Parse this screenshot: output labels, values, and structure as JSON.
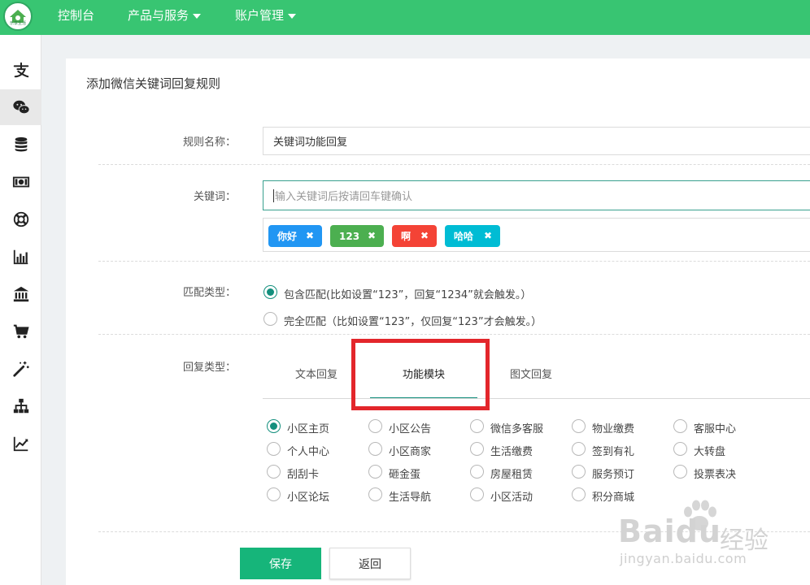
{
  "logo": {
    "label": "乐享生活"
  },
  "header": {
    "nav": [
      {
        "label": "控制台",
        "has_dropdown": false
      },
      {
        "label": "产品与服务",
        "has_dropdown": true
      },
      {
        "label": "账户管理",
        "has_dropdown": true
      }
    ],
    "accent": "#38c572"
  },
  "sidebar": {
    "items": [
      {
        "icon": "alipay-icon",
        "active": false
      },
      {
        "icon": "wechat-icon",
        "active": true
      },
      {
        "icon": "database-icon",
        "active": false
      },
      {
        "icon": "money-icon",
        "active": false
      },
      {
        "icon": "lifebuoy-icon",
        "active": false
      },
      {
        "icon": "bar-chart-icon",
        "active": false
      },
      {
        "icon": "bank-icon",
        "active": false
      },
      {
        "icon": "cart-icon",
        "active": false
      },
      {
        "icon": "magic-wand-icon",
        "active": false
      },
      {
        "icon": "sitemap-icon",
        "active": false
      },
      {
        "icon": "line-chart-icon",
        "active": false
      }
    ]
  },
  "form": {
    "title": "添加微信关键词回复规则",
    "rule_name": {
      "label": "规则名称：",
      "value": "关键词功能回复"
    },
    "keyword": {
      "label": "关键词：",
      "placeholder": "输入关键词后按请回车键确认",
      "tags": [
        {
          "text": "你好",
          "color": "#2196f3"
        },
        {
          "text": "123",
          "color": "#4caf50"
        },
        {
          "text": "啊",
          "color": "#f44336"
        },
        {
          "text": "哈哈",
          "color": "#00bcd4"
        }
      ],
      "remove_glyph": "✖"
    },
    "match_type": {
      "label": "匹配类型：",
      "options": [
        {
          "text": "包含匹配(比如设置“123”，回复“1234”就会触发。）",
          "checked": true
        },
        {
          "text": "完全匹配（比如设置“123”，仅回复“123”才会触发。）",
          "checked": false
        }
      ]
    },
    "reply_type": {
      "label": "回复类型：",
      "tabs": [
        {
          "label": "文本回复",
          "active": false
        },
        {
          "label": "功能模块",
          "active": true
        },
        {
          "label": "图文回复",
          "active": false
        }
      ],
      "modules": [
        {
          "text": "小区主页",
          "checked": true
        },
        {
          "text": "小区公告",
          "checked": false
        },
        {
          "text": "微信多客服",
          "checked": false
        },
        {
          "text": "物业缴费",
          "checked": false
        },
        {
          "text": "客服中心",
          "checked": false
        },
        {
          "text": "个人中心",
          "checked": false
        },
        {
          "text": "小区商家",
          "checked": false
        },
        {
          "text": "生活缴费",
          "checked": false
        },
        {
          "text": "签到有礼",
          "checked": false
        },
        {
          "text": "大转盘",
          "checked": false
        },
        {
          "text": "刮刮卡",
          "checked": false
        },
        {
          "text": "砸金蛋",
          "checked": false
        },
        {
          "text": "房屋租赁",
          "checked": false
        },
        {
          "text": "服务预订",
          "checked": false
        },
        {
          "text": "投票表决",
          "checked": false
        },
        {
          "text": "小区论坛",
          "checked": false
        },
        {
          "text": "生活导航",
          "checked": false
        },
        {
          "text": "小区活动",
          "checked": false
        },
        {
          "text": "积分商城",
          "checked": false
        }
      ]
    },
    "buttons": {
      "save": "保存",
      "back": "返回"
    }
  },
  "watermark": {
    "brand": "Baidu",
    "cn": "经验",
    "url": "jingyan.baidu.com"
  }
}
